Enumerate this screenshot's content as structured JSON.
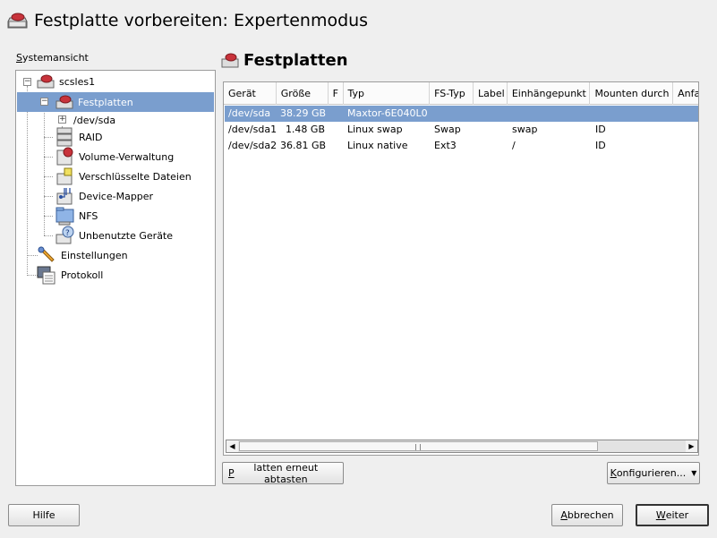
{
  "window": {
    "title": "Festplatte vorbereiten: Expertenmodus",
    "title_icon": "harddisk-icon"
  },
  "tree": {
    "label": "Systemansicht",
    "items": [
      {
        "label": "scsles1",
        "icon": "computer-disk-icon",
        "expanded": true
      },
      {
        "label": "Festplatten",
        "icon": "harddisk-icon",
        "expanded": true,
        "selected": true
      },
      {
        "label": "/dev/sda",
        "expanded": false
      },
      {
        "label": "RAID",
        "icon": "raid-icon"
      },
      {
        "label": "Volume-Verwaltung",
        "icon": "volume-management-icon"
      },
      {
        "label": "Verschlüsselte Dateien",
        "icon": "encrypted-files-icon"
      },
      {
        "label": "Device-Mapper",
        "icon": "device-mapper-icon"
      },
      {
        "label": "NFS",
        "icon": "nfs-folder-icon"
      },
      {
        "label": "Unbenutzte Geräte",
        "icon": "unused-devices-icon"
      },
      {
        "label": "Einstellungen",
        "icon": "settings-wrench-icon"
      },
      {
        "label": "Protokoll",
        "icon": "log-icon"
      }
    ]
  },
  "main": {
    "heading": "Festplatten",
    "heading_icon": "harddisk-icon",
    "columns": [
      "Gerät",
      "Größe",
      "F",
      "Typ",
      "FS-Typ",
      "Label",
      "Einhängepunkt",
      "Mounten durch",
      "Anfa"
    ],
    "rows": [
      [
        "/dev/sda",
        "38.29 GB",
        "",
        "Maxtor-6E040L0",
        "",
        "",
        "",
        "",
        ""
      ],
      [
        "/dev/sda1",
        "1.48 GB",
        "",
        "Linux swap",
        "Swap",
        "",
        "swap",
        "ID",
        ""
      ],
      [
        "/dev/sda2",
        "36.81 GB",
        "",
        "Linux native",
        "Ext3",
        "",
        "/",
        "ID",
        ""
      ]
    ],
    "selected_row": 0
  },
  "buttons": {
    "rescan_first": "P",
    "rescan_rest": "latten erneut abtasten",
    "configure_first": "K",
    "configure_rest": "onfigurieren...",
    "help": "Hilfe",
    "cancel_first": "A",
    "cancel_rest": "bbrechen",
    "next_first": "W",
    "next_rest": "eiter"
  },
  "colors": {
    "selection": "#7a9ece",
    "background": "#efefef"
  }
}
